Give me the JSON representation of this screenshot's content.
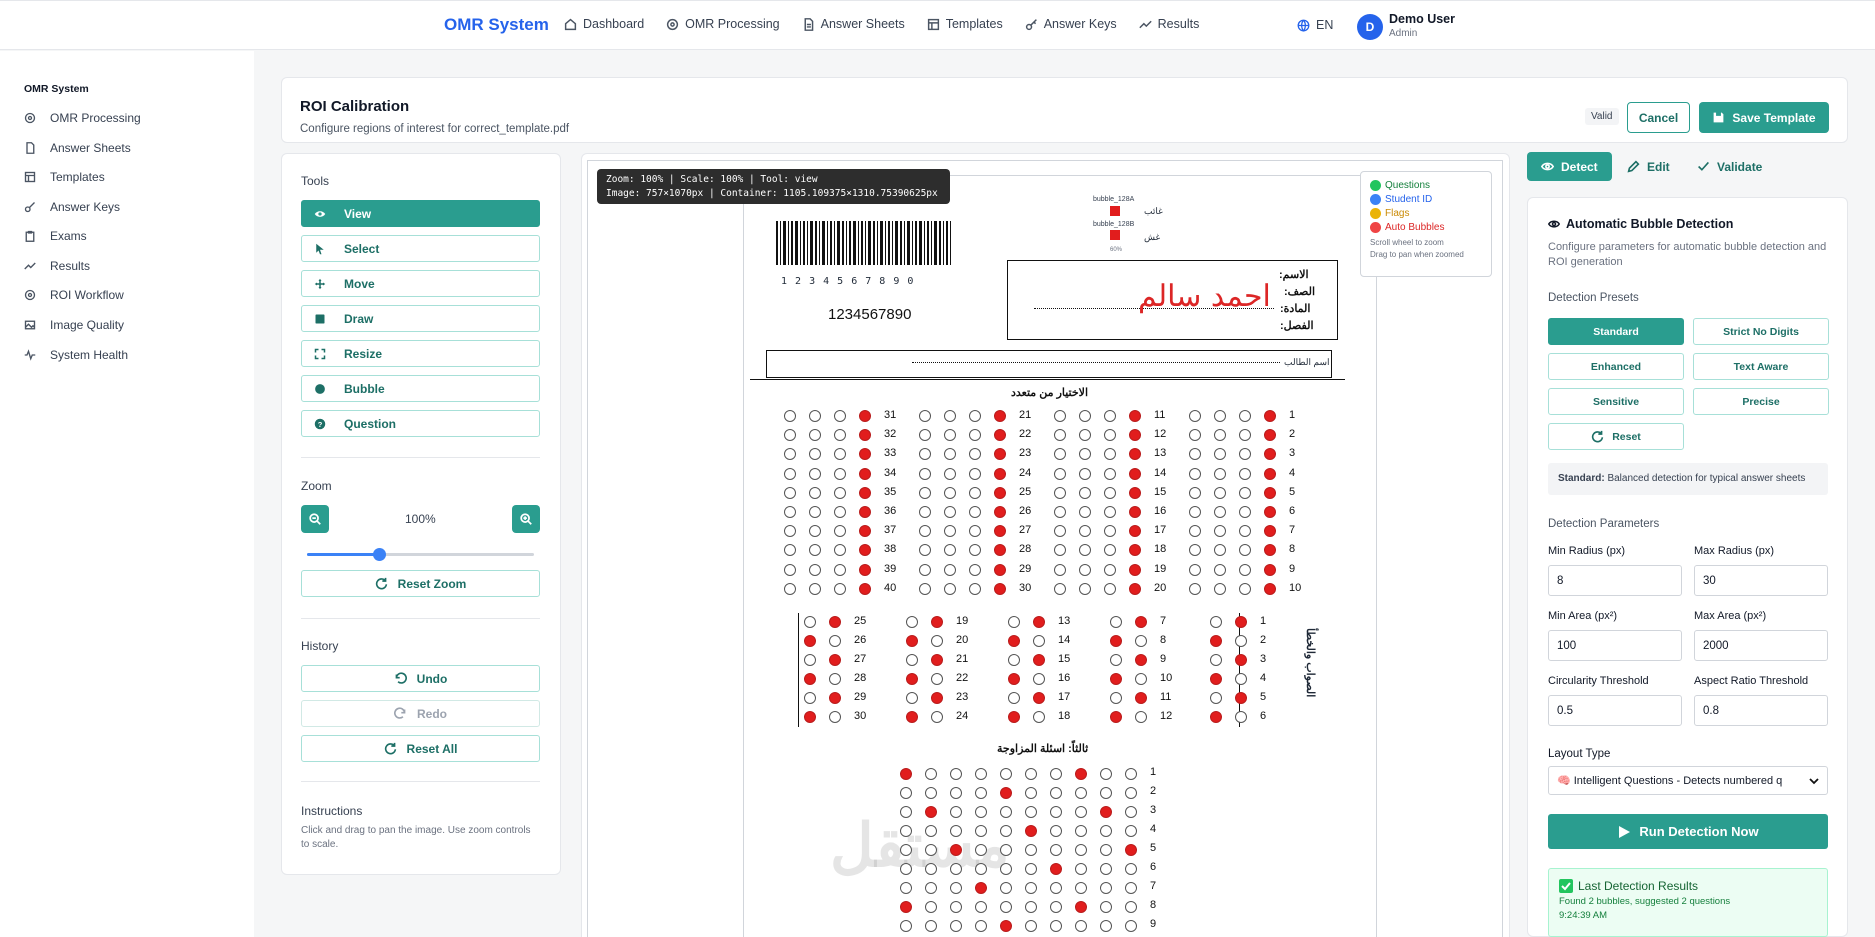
{
  "nav": {
    "brand": "OMR System",
    "links": [
      "Dashboard",
      "OMR Processing",
      "Answer Sheets",
      "Templates",
      "Answer Keys",
      "Results"
    ],
    "lang": "EN",
    "avatar_letter": "D",
    "user_name": "Demo User",
    "user_role": "Admin"
  },
  "sidebar": {
    "title": "OMR System",
    "items": [
      "OMR Processing",
      "Answer Sheets",
      "Templates",
      "Answer Keys",
      "Exams",
      "Results",
      "ROI Workflow",
      "Image Quality",
      "System Health"
    ]
  },
  "header": {
    "title": "ROI Calibration",
    "subtitle": "Configure regions of interest for correct_template.pdf",
    "badge": "Valid",
    "cancel": "Cancel",
    "save": "Save Template"
  },
  "tools": {
    "heading": "Tools",
    "items": [
      "View",
      "Select",
      "Move",
      "Draw",
      "Resize",
      "Bubble",
      "Question"
    ],
    "active": "View",
    "zoom_heading": "Zoom",
    "zoom_value": "100%",
    "zoom_slider_fraction": 0.3,
    "reset_zoom": "Reset Zoom",
    "history_heading": "History",
    "undo": "Undo",
    "redo": "Redo",
    "reset_all": "Reset All",
    "instructions_heading": "Instructions",
    "instructions_text": "Click and drag to pan the image. Use zoom controls to scale."
  },
  "canvas": {
    "zoom_info_line1": "Zoom: 100% | Scale: 100% | Tool: view",
    "zoom_info_line2": "Image: 757×1070px | Container: 1105.109375×1310.75390625px",
    "legend": [
      {
        "label": "Questions",
        "color": "#22c55e"
      },
      {
        "label": "Student ID",
        "color": "#3b82f6"
      },
      {
        "label": "Flags",
        "color": "#eab308"
      },
      {
        "label": "Auto Bubbles",
        "color": "#ef4444"
      }
    ],
    "hint1": "Scroll wheel to zoom",
    "hint2": "Drag to pan when zoomed",
    "barcode_digits": "1 2 3 4 5 6 7 8 9 0",
    "student_number": "1234567890",
    "field_name": "الاسم:",
    "field_class": "الصف:",
    "field_subject": "المادة:",
    "field_section": "الفصل:",
    "handwritten_name": "احمد سالم",
    "student_name_label": "اسم الطالب",
    "section1_title": "الاختيار من متعدد",
    "section2_title": "الصواب والخطأ",
    "section3_title": "ثالثاً: اسئلة المزاوجة",
    "absent_label": "غائب",
    "cheat_label": "غش",
    "bubble_tag1": "bubble_128A",
    "bubble_tag2": "bubble_128B",
    "tag_pct": "60%"
  },
  "right": {
    "tabs": [
      "Detect",
      "Edit",
      "Validate"
    ],
    "title": "Automatic Bubble Detection",
    "description": "Configure parameters for automatic bubble detection and ROI generation",
    "presets_heading": "Detection Presets",
    "presets": [
      "Standard",
      "Strict No Digits",
      "Enhanced",
      "Text Aware",
      "Sensitive",
      "Precise"
    ],
    "reset_label": "Reset",
    "preset_desc_bold": "Standard:",
    "preset_desc_text": "Balanced detection for typical answer sheets",
    "params_heading": "Detection Parameters",
    "params": [
      {
        "label": "Min Radius (px)",
        "value": "8"
      },
      {
        "label": "Max Radius (px)",
        "value": "30"
      },
      {
        "label": "Min Area (px²)",
        "value": "100"
      },
      {
        "label": "Max Area (px²)",
        "value": "2000"
      },
      {
        "label": "Circularity Threshold",
        "value": "0.5"
      },
      {
        "label": "Aspect Ratio Threshold",
        "value": "0.8"
      }
    ],
    "layout_heading": "Layout Type",
    "layout_value": "🧠 Intelligent Questions - Detects numbered q",
    "run_label": "Run Detection Now",
    "result_title": "Last Detection Results",
    "result_line1": "Found 2 bubbles, suggested 2 questions",
    "result_line2": "9:24:39 AM"
  },
  "colors": {
    "accent": "#2a9d8f",
    "brand": "#2563eb"
  }
}
